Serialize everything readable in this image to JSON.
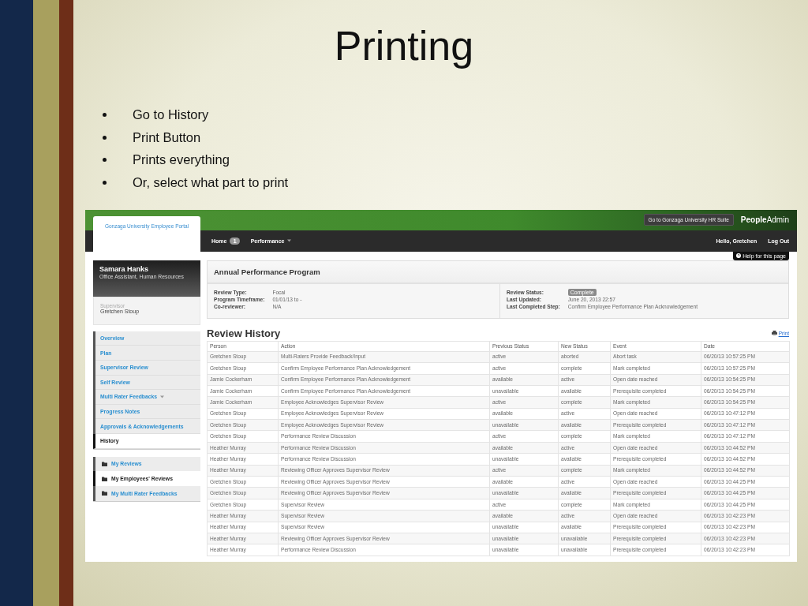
{
  "slide": {
    "title": "Printing",
    "bullets": [
      "Go to History",
      "Print Button",
      "Prints everything",
      "Or, select what part to print"
    ]
  },
  "portal": {
    "header": {
      "portal_tab": "Gonzaga University Employee Portal",
      "hr_suite_button": "Go to Gonzaga University HR Suite",
      "brand": "**People**Admin",
      "nav": [
        {
          "label": "Home",
          "kind": "badge",
          "badge": "1"
        },
        {
          "label": "Performance",
          "kind": "dropdown"
        }
      ],
      "greeting": "Hello, Gretchen",
      "logout": "Log Out",
      "help": "Help for this page"
    },
    "profile": {
      "name": "Samara Hanks",
      "title": "Office Assistant, Human Resources",
      "supervisor_label": "Supervisor",
      "supervisor": "Gretchen Stoup"
    },
    "sidebar_nav": [
      {
        "label": "Overview",
        "kind": "link",
        "selected": false
      },
      {
        "label": "Plan",
        "kind": "link",
        "selected": false
      },
      {
        "label": "Supervisor Review",
        "kind": "link",
        "selected": false
      },
      {
        "label": "Self Review",
        "kind": "link",
        "selected": false
      },
      {
        "label": "Multi Rater Feedbacks",
        "kind": "dropdown",
        "selected": false
      },
      {
        "label": "Progress Notes",
        "kind": "link",
        "selected": false
      },
      {
        "label": "Approvals & Acknowledgements",
        "kind": "link",
        "selected": false
      },
      {
        "label": "History",
        "kind": "link",
        "selected": true
      }
    ],
    "reviews_nav": [
      {
        "label": "My Reviews",
        "selected": false
      },
      {
        "label": "My Employees' Reviews",
        "selected": true
      },
      {
        "label": "My Multi Rater Feedbacks",
        "selected": false
      }
    ],
    "program": {
      "title": "Annual Performance Program",
      "left": [
        {
          "label": "Review Type:",
          "value": "Focal",
          "kind": "text"
        },
        {
          "label": "Program Timeframe:",
          "value": "01/01/13 to -",
          "kind": "text"
        },
        {
          "label": "Co-reviewer:",
          "value": "N/A",
          "kind": "text"
        }
      ],
      "right": [
        {
          "label": "Review Status:",
          "value": "Complete",
          "kind": "badge"
        },
        {
          "label": "Last Updated:",
          "value": "June 20, 2013 22:57",
          "kind": "text"
        },
        {
          "label": "Last Completed Step:",
          "value": "Confirm Employee Performance Plan Acknowledgement",
          "kind": "text"
        }
      ]
    },
    "history": {
      "title": "Review History",
      "print_link": "Print",
      "columns": [
        "Person",
        "Action",
        "Previous Status",
        "New Status",
        "Event",
        "Date"
      ],
      "rows": [
        [
          "Gretchen Stoup",
          "Multi-Raters Provide Feedback/Input",
          "active",
          "aborted",
          "Abort task",
          "06/20/13 10:57:25 PM"
        ],
        [
          "Gretchen Stoup",
          "Confirm Employee Performance Plan Acknowledgement",
          "active",
          "complete",
          "Mark completed",
          "06/20/13 10:57:25 PM"
        ],
        [
          "Jamie Cockerham",
          "Confirm Employee Performance Plan Acknowledgement",
          "available",
          "active",
          "Open date reached",
          "06/20/13 10:54:25 PM"
        ],
        [
          "Jamie Cockerham",
          "Confirm Employee Performance Plan Acknowledgement",
          "unavailable",
          "available",
          "Prerequisite completed",
          "06/20/13 10:54:25 PM"
        ],
        [
          "Jamie Cockerham",
          "Employee Acknowledges Supervisor Review",
          "active",
          "complete",
          "Mark completed",
          "06/20/13 10:54:25 PM"
        ],
        [
          "Gretchen Stoup",
          "Employee Acknowledges Supervisor Review",
          "available",
          "active",
          "Open date reached",
          "06/20/13 10:47:12 PM"
        ],
        [
          "Gretchen Stoup",
          "Employee Acknowledges Supervisor Review",
          "unavailable",
          "available",
          "Prerequisite completed",
          "06/20/13 10:47:12 PM"
        ],
        [
          "Gretchen Stoup",
          "Performance Review Discussion",
          "active",
          "complete",
          "Mark completed",
          "06/20/13 10:47:12 PM"
        ],
        [
          "Heather Murray",
          "Performance Review Discussion",
          "available",
          "active",
          "Open date reached",
          "06/20/13 10:44:52 PM"
        ],
        [
          "Heather Murray",
          "Performance Review Discussion",
          "unavailable",
          "available",
          "Prerequisite completed",
          "06/20/13 10:44:52 PM"
        ],
        [
          "Heather Murray",
          "Reviewing Officer Approves Supervisor Review",
          "active",
          "complete",
          "Mark completed",
          "06/20/13 10:44:52 PM"
        ],
        [
          "Gretchen Stoup",
          "Reviewing Officer Approves Supervisor Review",
          "available",
          "active",
          "Open date reached",
          "06/20/13 10:44:25 PM"
        ],
        [
          "Gretchen Stoup",
          "Reviewing Officer Approves Supervisor Review",
          "unavailable",
          "available",
          "Prerequisite completed",
          "06/20/13 10:44:25 PM"
        ],
        [
          "Gretchen Stoup",
          "Supervisor Review",
          "active",
          "complete",
          "Mark completed",
          "06/20/13 10:44:25 PM"
        ],
        [
          "Heather Murray",
          "Supervisor Review",
          "available",
          "active",
          "Open date reached",
          "06/20/13 10:42:23 PM"
        ],
        [
          "Heather Murray",
          "Supervisor Review",
          "unavailable",
          "available",
          "Prerequisite completed",
          "06/20/13 10:42:23 PM"
        ],
        [
          "Heather Murray",
          "Reviewing Officer Approves Supervisor Review",
          "unavailable",
          "unavailable",
          "Prerequisite completed",
          "06/20/13 10:42:23 PM"
        ],
        [
          "Heather Murray",
          "Performance Review Discussion",
          "unavailable",
          "unavailable",
          "Prerequisite completed",
          "06/20/13 10:42:23 PM"
        ]
      ]
    }
  }
}
